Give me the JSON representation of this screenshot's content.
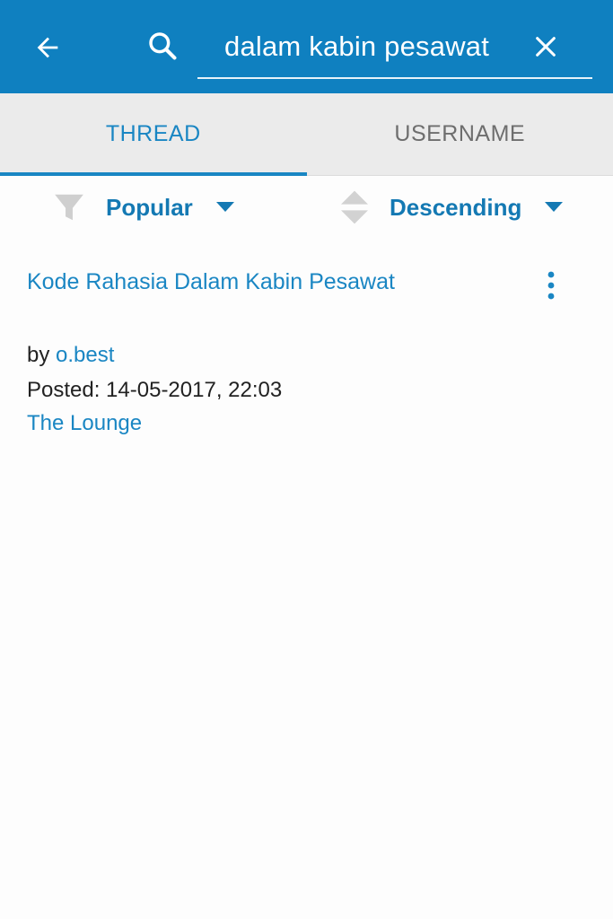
{
  "colors": {
    "header_bg": "#0f80c0",
    "accent": "#1a86c3",
    "tab_bar_bg": "#ebebeb",
    "inactive_tab_text": "#6e6e6e",
    "icon_gray": "#cfcfcf"
  },
  "header": {
    "back_icon": "arrow-left-icon",
    "search_icon": "search-icon",
    "search_query": "dalam kabin pesawat",
    "clear_icon": "close-icon"
  },
  "tabs": [
    {
      "label": "THREAD",
      "active": true
    },
    {
      "label": "USERNAME",
      "active": false
    }
  ],
  "filters": {
    "filter_icon": "funnel-icon",
    "filter_label": "Popular",
    "order_icon": "sort-icon",
    "order_label": "Descending",
    "dropdown_icon": "caret-down-icon"
  },
  "results": [
    {
      "title": "Kode Rahasia Dalam Kabin Pesawat",
      "by_prefix": "by",
      "author": "o.best",
      "posted": "Posted: 14-05-2017, 22:03",
      "forum": "The Lounge",
      "menu_icon": "more-vertical-icon"
    }
  ]
}
